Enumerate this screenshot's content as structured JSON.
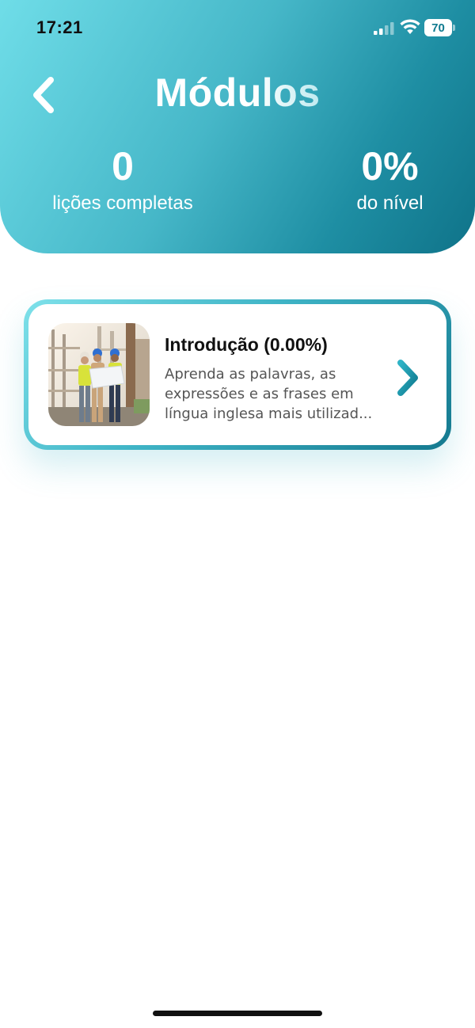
{
  "status_bar": {
    "time": "17:21",
    "battery": "70",
    "icons": [
      "signal-icon",
      "wifi-icon",
      "battery-icon"
    ]
  },
  "header": {
    "title": "Módulos",
    "back_icon": "chevron-left-icon",
    "stats": [
      {
        "value": "0",
        "label": "lições completas"
      },
      {
        "value": "0%",
        "label": "do nível"
      }
    ]
  },
  "modules": [
    {
      "title": "Introdução (0.00%)",
      "description": "Aprenda as palavras, as expressões e as frases em língua inglesa mais utilizad...",
      "thumbnail": "construction-workers-image",
      "chevron_icon": "chevron-right-icon"
    }
  ],
  "colors": {
    "header_gradient_start": "#6fdde8",
    "header_gradient_end": "#0f7389",
    "accent": "#1a9aae",
    "title_text": "#111111",
    "description_text": "#555555"
  }
}
